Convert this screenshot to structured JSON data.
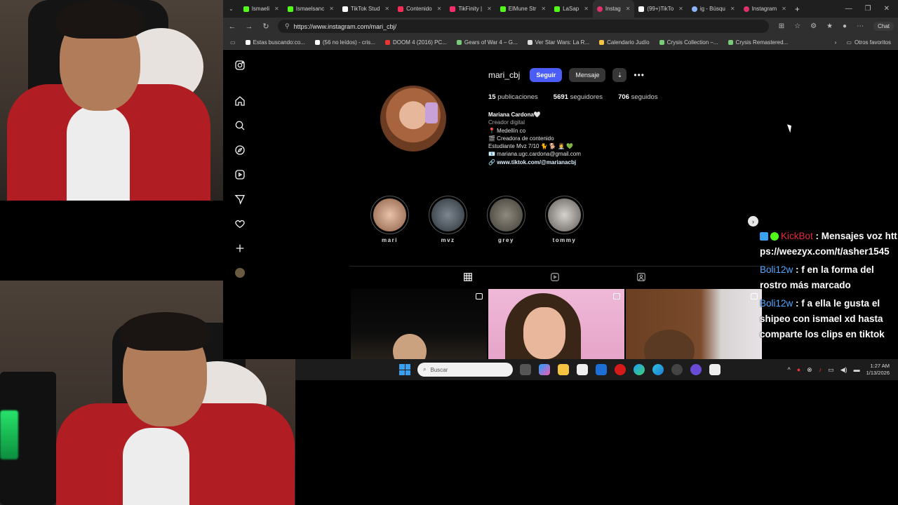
{
  "browser": {
    "tabs": [
      {
        "label": "Ismaeli",
        "color": "#53fc18"
      },
      {
        "label": "Ismaelsanc",
        "color": "#53fc18"
      },
      {
        "label": "TikTok Stud",
        "color": "#ffffff"
      },
      {
        "label": "Contenido",
        "color": "#fe2c55"
      },
      {
        "label": "TikFinity |",
        "color": "#ff2e6b"
      },
      {
        "label": "ElMune Str",
        "color": "#53fc18"
      },
      {
        "label": "LaSap",
        "color": "#53fc18"
      },
      {
        "label": "Instag",
        "color": "#e1306c"
      },
      {
        "label": "(99+)TikTo",
        "color": "#ffffff"
      },
      {
        "label": "ig - Búsqu",
        "color": "#8ab4f8"
      },
      {
        "label": "Instagram",
        "color": "#e1306c"
      }
    ],
    "url": "https://www.instagram.com/mari_cbj/",
    "copilot_label": "Chat",
    "bookmarks": [
      {
        "label": "Estas buscando:co...",
        "color": "#ffffff"
      },
      {
        "label": "(56 no leídos) - cris...",
        "color": "#ffffff"
      },
      {
        "label": "DOOM 4 (2016) PC...",
        "color": "#e33"
      },
      {
        "label": "Gears of War 4 – G...",
        "color": "#7c7"
      },
      {
        "label": "Ver Star Wars: La R...",
        "color": "#ddd"
      },
      {
        "label": "Calendario Judío",
        "color": "#f5c542"
      },
      {
        "label": "Crysis Collection –...",
        "color": "#7c7"
      },
      {
        "label": "Crysis Remastered...",
        "color": "#7c7"
      }
    ],
    "other_favorites": "Otros favoritos"
  },
  "profile": {
    "username": "mari_cbj",
    "follow_label": "Seguir",
    "message_label": "Mensaje",
    "posts_count": "15",
    "posts_label": "publicaciones",
    "followers_count": "5691",
    "followers_label": "seguidores",
    "following_count": "706",
    "following_label": "seguidos",
    "bio": {
      "name": "Mariana Cardona🤍",
      "category": "Creador digital",
      "lines": [
        "📍 Medellín co",
        "🎬 Creadora de contenido",
        "Estudiante Mvz 7/10 🐈 🐕 👩‍⚕️ 💚",
        "📧 mariana.ugc.cardona@gmail.com"
      ],
      "link": "www.tiktok.com/@marianacbj"
    },
    "highlights": [
      {
        "label": "mari",
        "color": "#caa08a"
      },
      {
        "label": "mvz",
        "color": "#4a5560"
      },
      {
        "label": "grey",
        "color": "#6f6a60"
      },
      {
        "label": "tommy",
        "color": "#a8a4a0"
      }
    ]
  },
  "chat": [
    {
      "user": "KickBot",
      "bot": true,
      "text": "Mensajes voz https://weezyx.com/t/asher1545"
    },
    {
      "user": "Boli12w",
      "bot": false,
      "text": "f en la forma del rostro más marcado"
    },
    {
      "user": "Boli12w",
      "bot": false,
      "text": "f a ella le gusta el shipeo con ismael xd hasta comparte los clips en tiktok"
    }
  ],
  "taskbar": {
    "search_placeholder": "Buscar",
    "time": "1:27 AM",
    "date": "1/13/2026"
  }
}
